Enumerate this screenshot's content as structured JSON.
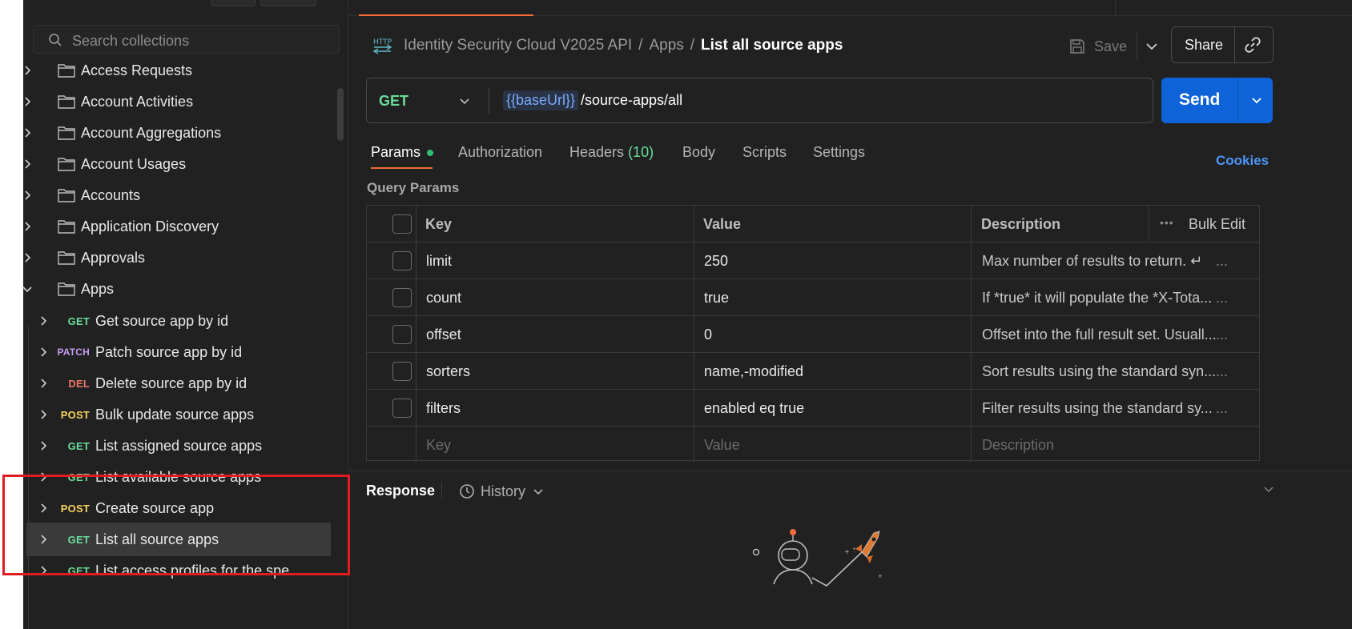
{
  "sidebar": {
    "search_placeholder": "Search collections",
    "folders": [
      {
        "label": "Access Requests",
        "expanded": false
      },
      {
        "label": "Account Activities",
        "expanded": false
      },
      {
        "label": "Account Aggregations",
        "expanded": false
      },
      {
        "label": "Account Usages",
        "expanded": false
      },
      {
        "label": "Accounts",
        "expanded": false
      },
      {
        "label": "Application Discovery",
        "expanded": false
      },
      {
        "label": "Approvals",
        "expanded": false
      },
      {
        "label": "Apps",
        "expanded": true
      }
    ],
    "requests": [
      {
        "method": "GET",
        "label": "Get source app by id"
      },
      {
        "method": "PATCH",
        "label": "Patch source app by id"
      },
      {
        "method": "DEL",
        "label": "Delete source app by id"
      },
      {
        "method": "POST",
        "label": "Bulk update source apps"
      },
      {
        "method": "GET",
        "label": "List assigned source apps"
      },
      {
        "method": "GET",
        "label": "List available source apps"
      },
      {
        "method": "POST",
        "label": "Create source app"
      },
      {
        "method": "GET",
        "label": "List all source apps",
        "active": true
      },
      {
        "method": "GET",
        "label": "List access profiles for the spe"
      }
    ]
  },
  "breadcrumb": {
    "collection": "Identity Security Cloud V2025 API",
    "folder": "Apps",
    "current": "List all source apps",
    "separator": "/"
  },
  "toolbar": {
    "save_label": "Save",
    "share_label": "Share"
  },
  "request": {
    "method": "GET",
    "url_variable": "{{baseUrl}}",
    "url_path": "/source-apps/all",
    "send_label": "Send"
  },
  "tabs": {
    "params": "Params",
    "authorization": "Authorization",
    "headers": "Headers",
    "headers_count": "(10)",
    "body": "Body",
    "scripts": "Scripts",
    "settings": "Settings",
    "cookies": "Cookies"
  },
  "query_params": {
    "section_label": "Query Params",
    "headers": {
      "key": "Key",
      "value": "Value",
      "description": "Description",
      "more": "•••",
      "bulk_edit": "Bulk Edit"
    },
    "rows": [
      {
        "key": "limit",
        "value": "250",
        "description": "Max number of results to return. ↵"
      },
      {
        "key": "count",
        "value": "true",
        "description": "If *true* it will populate the *X-Tota..."
      },
      {
        "key": "offset",
        "value": "0",
        "description": "Offset into the full result set. Usuall..."
      },
      {
        "key": "sorters",
        "value": "name,-modified",
        "description": "Sort results using the standard syn..."
      },
      {
        "key": "filters",
        "value": "enabled eq true",
        "description": "Filter results using the standard sy..."
      }
    ],
    "row_more": "...",
    "placeholder": {
      "key": "Key",
      "value": "Value",
      "description": "Description"
    }
  },
  "response": {
    "label": "Response",
    "history_label": "History"
  },
  "colors": {
    "get": "#6bdd9a",
    "post": "#f7d35b",
    "patch": "#c79bf2",
    "del": "#f0776b",
    "accent": "#f26b3a",
    "send": "#0f63d8",
    "highlight": "#e11b22"
  }
}
